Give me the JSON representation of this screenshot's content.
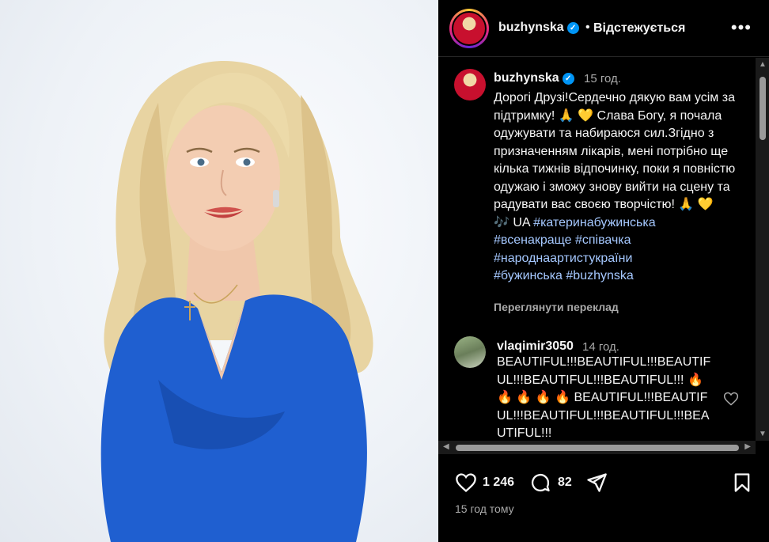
{
  "photo": {
    "alt_subject": "woman-portrait"
  },
  "header": {
    "username": "buzhynska",
    "separator": "•",
    "follow_status": "Відстежується",
    "more_icon": "more-icon"
  },
  "caption": {
    "username": "buzhynska",
    "time": "15 год.",
    "text_main": "Дорогі Друзі!Сердечно дякую вам усім за підтримку! 🙏 💛 Слава Богу, я почала одужувати та набираюся сил.Згідно з призначенням лікарів, мені потрібно ще кілька тижнів відпочинку, поки я повністю одужаю і зможу знову вийти на сцену та радувати вас своєю творчістю! 🙏 💛",
    "text_prefix": "🎶 UA",
    "hashtags": [
      "#катеринабужинська",
      "#всенакраще",
      "#співачка",
      "#народнаартистукраїни",
      "#бужинська",
      "#buzhynska"
    ],
    "translate": "Переглянути переклад"
  },
  "comment": {
    "username": "vlaqimir3050",
    "time": "14 год.",
    "text": "BEAUTIFUL!!!BEAUTIFUL!!!BEAUTIFUL!!!BEAUTIFUL!!!BEAUTIFUL!!! 🔥 🔥 🔥 🔥 🔥 BEAUTIFUL!!!BEAUTIFUL!!!BEAUTIFUL!!!BEAUTIFUL!!!BEAUTIFUL!!!"
  },
  "actions": {
    "likes": "1 246",
    "comments": "82",
    "posted": "15 год тому"
  },
  "colors": {
    "accent": "#0095f6",
    "hashtag": "#a5c8ff",
    "secondary_text": "#a8a8a8"
  }
}
